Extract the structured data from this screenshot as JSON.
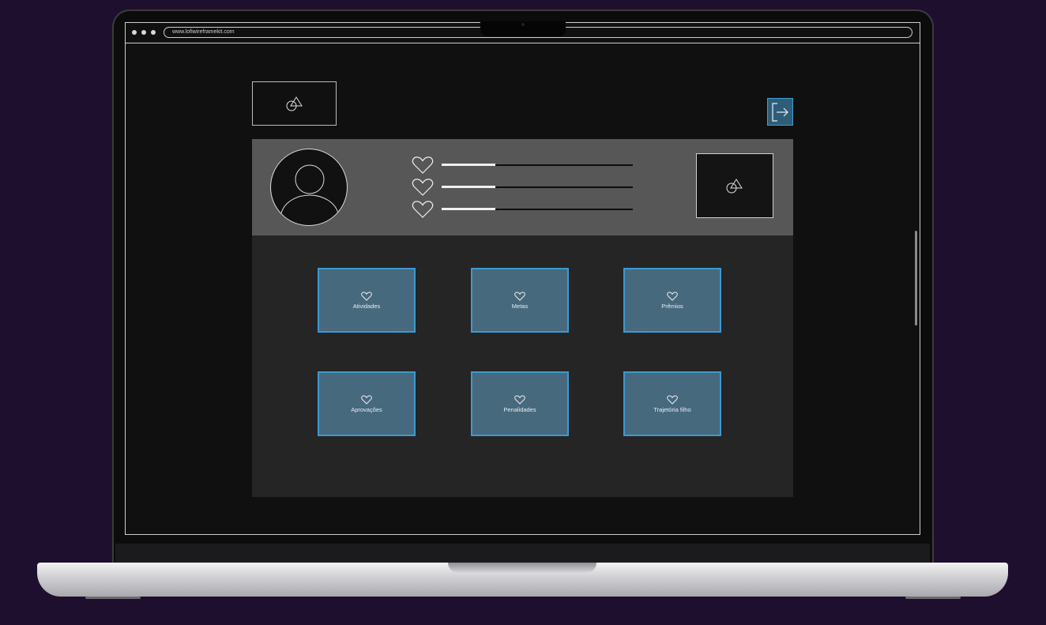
{
  "browser": {
    "url": "www.lofiwireframekit.com"
  },
  "header": {
    "logo_icon": "shape-placeholder-icon",
    "logout_icon": "logout-icon"
  },
  "profile": {
    "avatar_icon": "user-avatar-icon",
    "image_icon": "shape-placeholder-icon",
    "stats": [
      {
        "icon": "heart-icon",
        "progress": 0.28
      },
      {
        "icon": "heart-icon",
        "progress": 0.28
      },
      {
        "icon": "heart-icon",
        "progress": 0.28
      }
    ]
  },
  "menu": {
    "items": [
      {
        "icon": "heart-icon",
        "label": "Atividades"
      },
      {
        "icon": "heart-icon",
        "label": "Metas"
      },
      {
        "icon": "heart-icon",
        "label": "Prêmios"
      },
      {
        "icon": "heart-icon",
        "label": "Aprovações"
      },
      {
        "icon": "heart-icon",
        "label": "Penalidades"
      },
      {
        "icon": "heart-icon",
        "label": "Trajetória filho"
      }
    ]
  },
  "colors": {
    "background": "#1e0f2e",
    "screen": "#101010",
    "panel_top": "#575757",
    "panel_bottom": "#252525",
    "card": "#47697d",
    "card_border": "#3c9ad0"
  }
}
